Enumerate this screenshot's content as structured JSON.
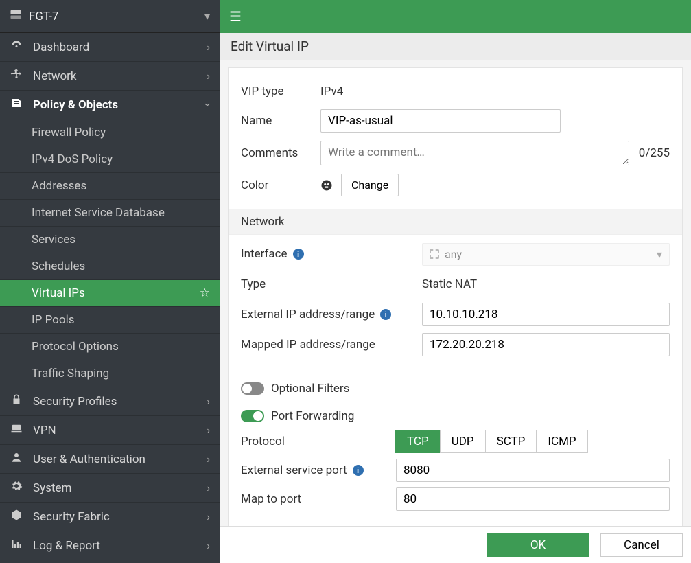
{
  "device_name": "FGT-7",
  "nav": {
    "dashboard": "Dashboard",
    "network": "Network",
    "policy_objects": "Policy & Objects",
    "policy_sub": {
      "firewall_policy": "Firewall Policy",
      "ipv4_dos": "IPv4 DoS Policy",
      "addresses": "Addresses",
      "isdb": "Internet Service Database",
      "services": "Services",
      "schedules": "Schedules",
      "vips": "Virtual IPs",
      "ip_pools": "IP Pools",
      "protocol_options": "Protocol Options",
      "traffic_shaping": "Traffic Shaping"
    },
    "security_profiles": "Security Profiles",
    "vpn": "VPN",
    "user_auth": "User & Authentication",
    "system": "System",
    "security_fabric": "Security Fabric",
    "log_report": "Log & Report"
  },
  "page_title": "Edit Virtual IP",
  "form": {
    "vip_type_label": "VIP type",
    "vip_type_value": "IPv4",
    "name_label": "Name",
    "name_value": "VIP-as-usual",
    "comments_label": "Comments",
    "comments_placeholder": "Write a comment…",
    "comments_counter": "0/255",
    "color_label": "Color",
    "change_btn": "Change"
  },
  "network": {
    "section": "Network",
    "interface_label": "Interface",
    "interface_value": "any",
    "type_label": "Type",
    "type_value": "Static NAT",
    "ext_ip_label": "External IP address/range",
    "ext_ip_value": "10.10.10.218",
    "mapped_ip_label": "Mapped IP address/range",
    "mapped_ip_value": "172.20.20.218"
  },
  "optional_filters": "Optional Filters",
  "port_forwarding": {
    "section": "Port Forwarding",
    "protocol_label": "Protocol",
    "protocols": {
      "tcp": "TCP",
      "udp": "UDP",
      "sctp": "SCTP",
      "icmp": "ICMP"
    },
    "ext_port_label": "External service port",
    "ext_port_value": "8080",
    "map_port_label": "Map to port",
    "map_port_value": "80"
  },
  "footer": {
    "ok": "OK",
    "cancel": "Cancel"
  }
}
